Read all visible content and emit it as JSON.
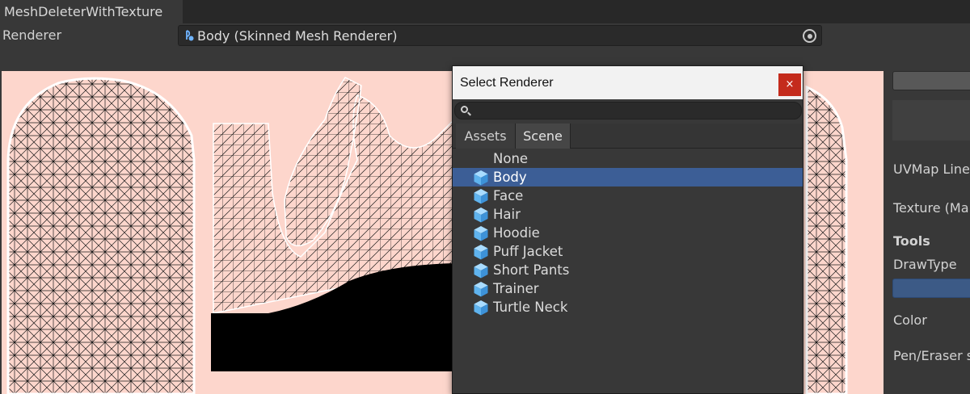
{
  "window": {
    "title": "MeshDeleterWithTexture"
  },
  "renderer": {
    "label": "Renderer",
    "value": "Body (Skinned Mesh Renderer)",
    "icon": "skinned-mesh-renderer-icon"
  },
  "side_panel": {
    "uvmap_label": "UVMap Line",
    "texture_label": "Texture (Ma",
    "tools_heading": "Tools",
    "drawtype_label": "DrawType",
    "color_label": "Color",
    "pen_eraser_label": "Pen/Eraser s"
  },
  "dialog": {
    "title": "Select Renderer",
    "close_label": "×",
    "search_value": "",
    "tabs": [
      {
        "label": "Assets",
        "active": false
      },
      {
        "label": "Scene",
        "active": true
      }
    ],
    "items": [
      {
        "label": "None",
        "icon": "",
        "selected": false
      },
      {
        "label": "Body",
        "icon": "cube-icon",
        "selected": true
      },
      {
        "label": "Face",
        "icon": "cube-icon",
        "selected": false
      },
      {
        "label": "Hair",
        "icon": "cube-icon",
        "selected": false
      },
      {
        "label": "Hoodie",
        "icon": "cube-icon",
        "selected": false
      },
      {
        "label": "Puff Jacket",
        "icon": "cube-icon",
        "selected": false
      },
      {
        "label": "Short Pants",
        "icon": "cube-icon",
        "selected": false
      },
      {
        "label": "Trainer",
        "icon": "cube-icon",
        "selected": false
      },
      {
        "label": "Turtle Neck",
        "icon": "cube-icon",
        "selected": false
      }
    ]
  },
  "colors": {
    "background": "#383838",
    "uv_background": "#fdd6cc",
    "selection": "#3c5e96",
    "close": "#c42b1c"
  }
}
